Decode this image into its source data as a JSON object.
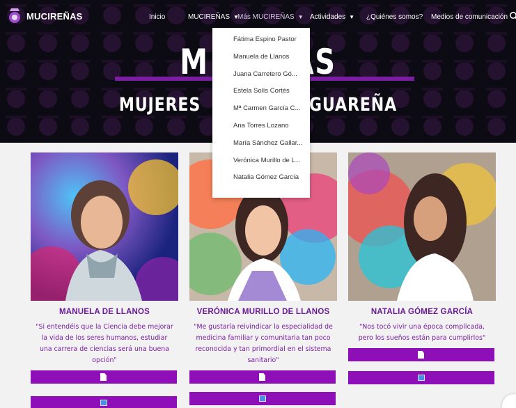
{
  "site": {
    "logo_text": "MUCIREÑAS"
  },
  "nav": {
    "items": [
      {
        "label": "Inicio",
        "dropdown": false
      },
      {
        "label": "MUCIREÑAS",
        "dropdown": true
      },
      {
        "label": "Más MUCIREÑAS",
        "dropdown": true
      },
      {
        "label": "Actividades",
        "dropdown": true
      },
      {
        "label": "¿Quiénes somos?",
        "dropdown": false
      },
      {
        "label": "Medios de comunicación",
        "dropdown": false
      }
    ]
  },
  "hero": {
    "title_left": "M",
    "title_right": "AS",
    "subtitle_left": "MUJERES",
    "subtitle_right": "GUAREÑA"
  },
  "dropdown": {
    "items": [
      "Fátima Espino Pastor",
      "Manuela de Llanos",
      "Juana Carretero Gó...",
      "Estela Solís Cortés",
      "Mª Carmen García C...",
      "Ana Torres Lozano",
      "María Sánchez Gallar...",
      "Verónica Murillo de L...",
      "Natalia Gómez García"
    ]
  },
  "cards": [
    {
      "name": "MANUELA DE LLANOS",
      "quote": "\"Si entendéis que la Ciencia debe mejorar la vida de los seres humanos, estudiar una carrera de ciencias será una buena opción\""
    },
    {
      "name": "VERÓNICA MURILLO DE LLANOS",
      "quote": "\"Me gustaría reivindicar la especialidad de medicina familiar y comunitaria tan poco reconocida y tan primordial en el sistema sanitario\""
    },
    {
      "name": "NATALIA GÓMEZ GARCÍA",
      "quote": "\"Nos tocó vivir una época complicada, pero los sueños están para cumplirlos\""
    }
  ],
  "colors": {
    "accent": "#8e0fb7",
    "title": "#6a1b9a",
    "hero_bg": "#0c0a12"
  }
}
